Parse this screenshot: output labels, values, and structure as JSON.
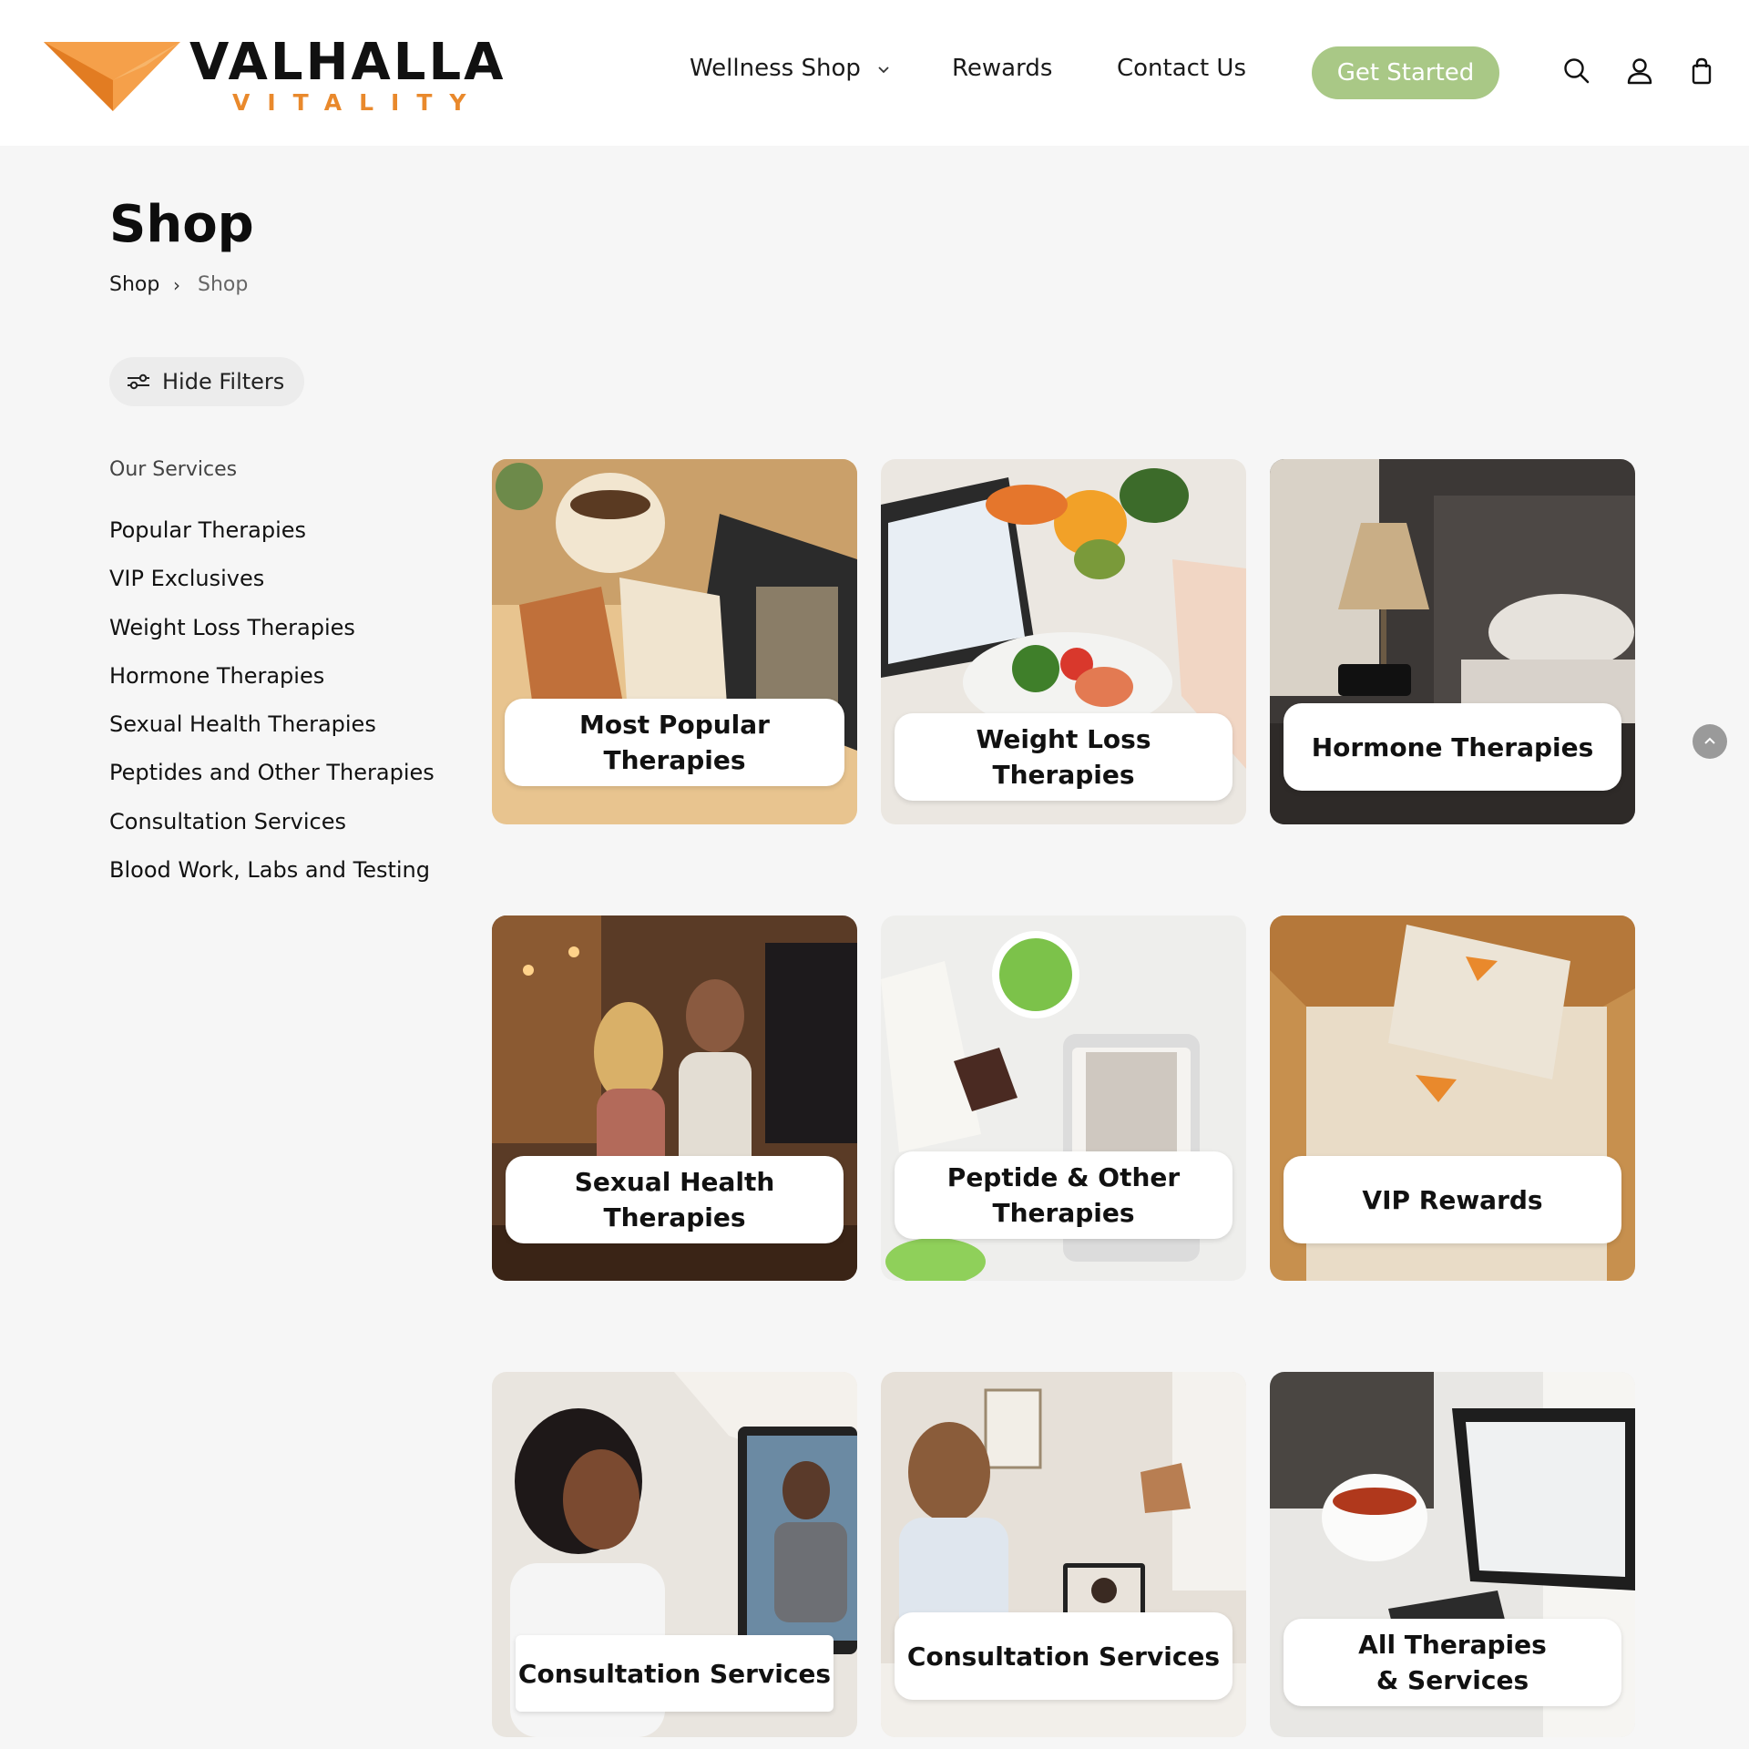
{
  "brand": {
    "name": "VALHALLA",
    "tagline": "VITALITY",
    "accent": "#e9892c"
  },
  "nav": {
    "items": [
      "Wellness Shop",
      "Rewards",
      "Contact Us"
    ],
    "cta": "Get Started",
    "cta_color": "#a9c886",
    "icons": [
      "search-icon",
      "account-icon",
      "cart-bag-icon"
    ]
  },
  "page": {
    "title": "Shop",
    "breadcrumb": [
      "Shop",
      "Shop"
    ],
    "filter_button": "Hide Filters"
  },
  "sidebar": {
    "heading": "Our Services",
    "items": [
      "Popular Therapies",
      "VIP Exclusives",
      "Weight Loss Therapies",
      "Hormone Therapies",
      "Sexual Health Therapies",
      "Peptides and Other Therapies",
      "Consultation Services",
      "Blood Work, Labs and Testing"
    ]
  },
  "tiles": [
    {
      "label": "Most Popular Therapies"
    },
    {
      "label_lines": [
        "Weight Loss",
        "Therapies"
      ]
    },
    {
      "label": "Hormone Therapies"
    },
    {
      "label_lines": [
        "Sexual Health",
        "Therapies"
      ]
    },
    {
      "label_lines": [
        "Peptide & Other",
        "Therapies"
      ]
    },
    {
      "label": "VIP Rewards"
    },
    {
      "label": "Consultation Services"
    },
    {
      "label": "Consultation Services"
    },
    {
      "label_lines": [
        "All Therapies",
        "& Services"
      ]
    }
  ]
}
